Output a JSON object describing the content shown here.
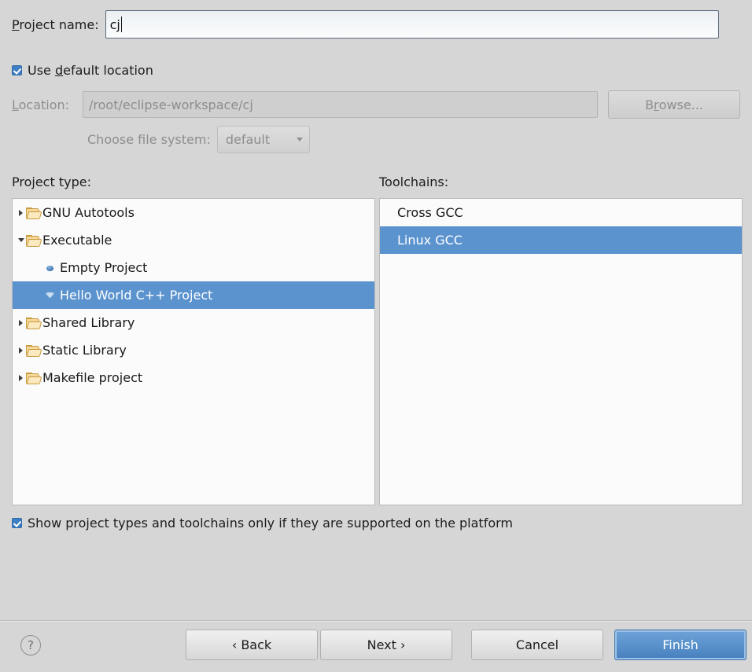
{
  "project_name": {
    "label_prefix": "P",
    "label_rest": "roject name:",
    "value": "cj",
    "placeholder": ""
  },
  "use_default_location": {
    "label_a": "Use ",
    "label_mnem": "d",
    "label_b": "efault location",
    "checked": true
  },
  "location": {
    "label_mnem": "L",
    "label_rest": "ocation:",
    "value": "/root/eclipse-workspace/cj",
    "browse_a": "B",
    "browse_mnem": "r",
    "browse_b": "owse..."
  },
  "file_system": {
    "label": "Choose file system:",
    "selected": "default"
  },
  "project_type": {
    "header": "Project type:",
    "items": [
      {
        "label": "GNU Autotools",
        "icon": "folder-icon",
        "state": "collapsed",
        "depth": 1,
        "selected": false
      },
      {
        "label": "Executable",
        "icon": "folder-icon",
        "state": "expanded",
        "depth": 1,
        "selected": false
      },
      {
        "label": "Empty Project",
        "icon": "gem-icon",
        "state": "none",
        "depth": 2,
        "selected": false
      },
      {
        "label": "Hello World C++ Project",
        "icon": "gem-icon",
        "state": "none",
        "depth": 2,
        "selected": true
      },
      {
        "label": "Shared Library",
        "icon": "folder-icon",
        "state": "collapsed",
        "depth": 1,
        "selected": false
      },
      {
        "label": "Static Library",
        "icon": "folder-icon",
        "state": "collapsed",
        "depth": 1,
        "selected": false
      },
      {
        "label": "Makefile project",
        "icon": "folder-icon",
        "state": "collapsed",
        "depth": 1,
        "selected": false
      }
    ]
  },
  "toolchains": {
    "header": "Toolchains:",
    "items": [
      {
        "label": "Cross GCC",
        "selected": false
      },
      {
        "label": "Linux GCC",
        "selected": true
      }
    ]
  },
  "show_supported_only": {
    "label": "Show project types and toolchains only if they are supported on the platform",
    "checked": true
  },
  "buttons": {
    "help": "?",
    "back": "‹ Back",
    "next": "Next ›",
    "cancel": "Cancel",
    "finish": "Finish"
  },
  "colors": {
    "selection": "#5b93cf",
    "dialog_bg": "#d6d6d6",
    "list_bg": "#fbfbfb",
    "disabled_text": "#8d8d8d",
    "finish_accent": "#5a92cc"
  }
}
